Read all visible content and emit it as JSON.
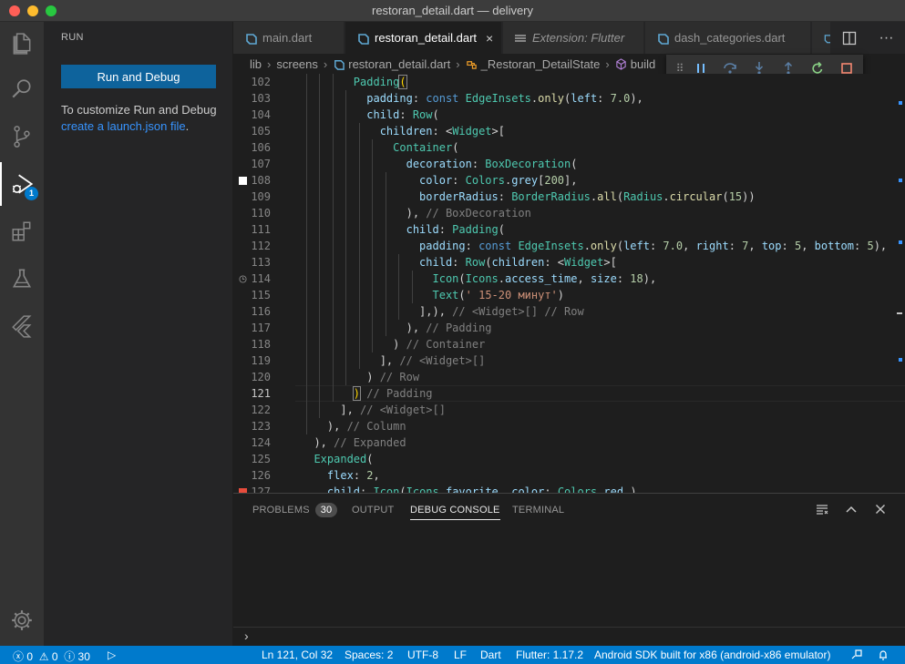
{
  "window": {
    "title": "restoran_detail.dart — delivery"
  },
  "colors": {
    "accent": "#007acc",
    "red": "#ff5f57",
    "yellow": "#febc2e",
    "green": "#28c840"
  },
  "activity_bar": {
    "icons": [
      "files-icon",
      "search-icon",
      "source-control-icon",
      "run-debug-icon",
      "extensions-icon",
      "testing-icon",
      "flutter-icon",
      "gear-icon"
    ],
    "debug_badge": "1"
  },
  "sidebar": {
    "header": "RUN",
    "run_button": "Run and Debug",
    "info_text": "To customize Run and Debug",
    "info_link": "create a launch.json file",
    "info_suffix": "."
  },
  "tabs": [
    {
      "label": "main.dart"
    },
    {
      "label": "restoran_detail.dart",
      "close": "×"
    },
    {
      "label": "Extension: Flutter"
    },
    {
      "label": "dash_categories.dart"
    }
  ],
  "tab_tools": {
    "split": "split-editor-icon",
    "more": "···"
  },
  "breadcrumb": {
    "items": [
      "lib",
      "screens",
      "restoran_detail.dart",
      "_Restoran_DetailState",
      "build"
    ]
  },
  "line_numbers": [
    "102",
    "103",
    "104",
    "105",
    "106",
    "107",
    "108",
    "109",
    "110",
    "111",
    "112",
    "113",
    "114",
    "115",
    "116",
    "117",
    "118",
    "119",
    "120",
    "121",
    "122",
    "123",
    "124",
    "125",
    "126",
    "127"
  ],
  "panel": {
    "tabs": {
      "problems": "PROBLEMS",
      "problems_count": "30",
      "output": "OUTPUT",
      "debug_console": "DEBUG CONSOLE",
      "terminal": "TERMINAL"
    },
    "prompt": "›"
  },
  "status": {
    "errors": "0",
    "warnings": "0",
    "infos": "30",
    "position": "Ln 121, Col 32",
    "spaces": "Spaces: 2",
    "encoding": "UTF-8",
    "eol": "LF",
    "language": "Dart",
    "flutter": "Flutter: 1.17.2",
    "device": "Android SDK built for x86 (android-x86 emulator)"
  }
}
